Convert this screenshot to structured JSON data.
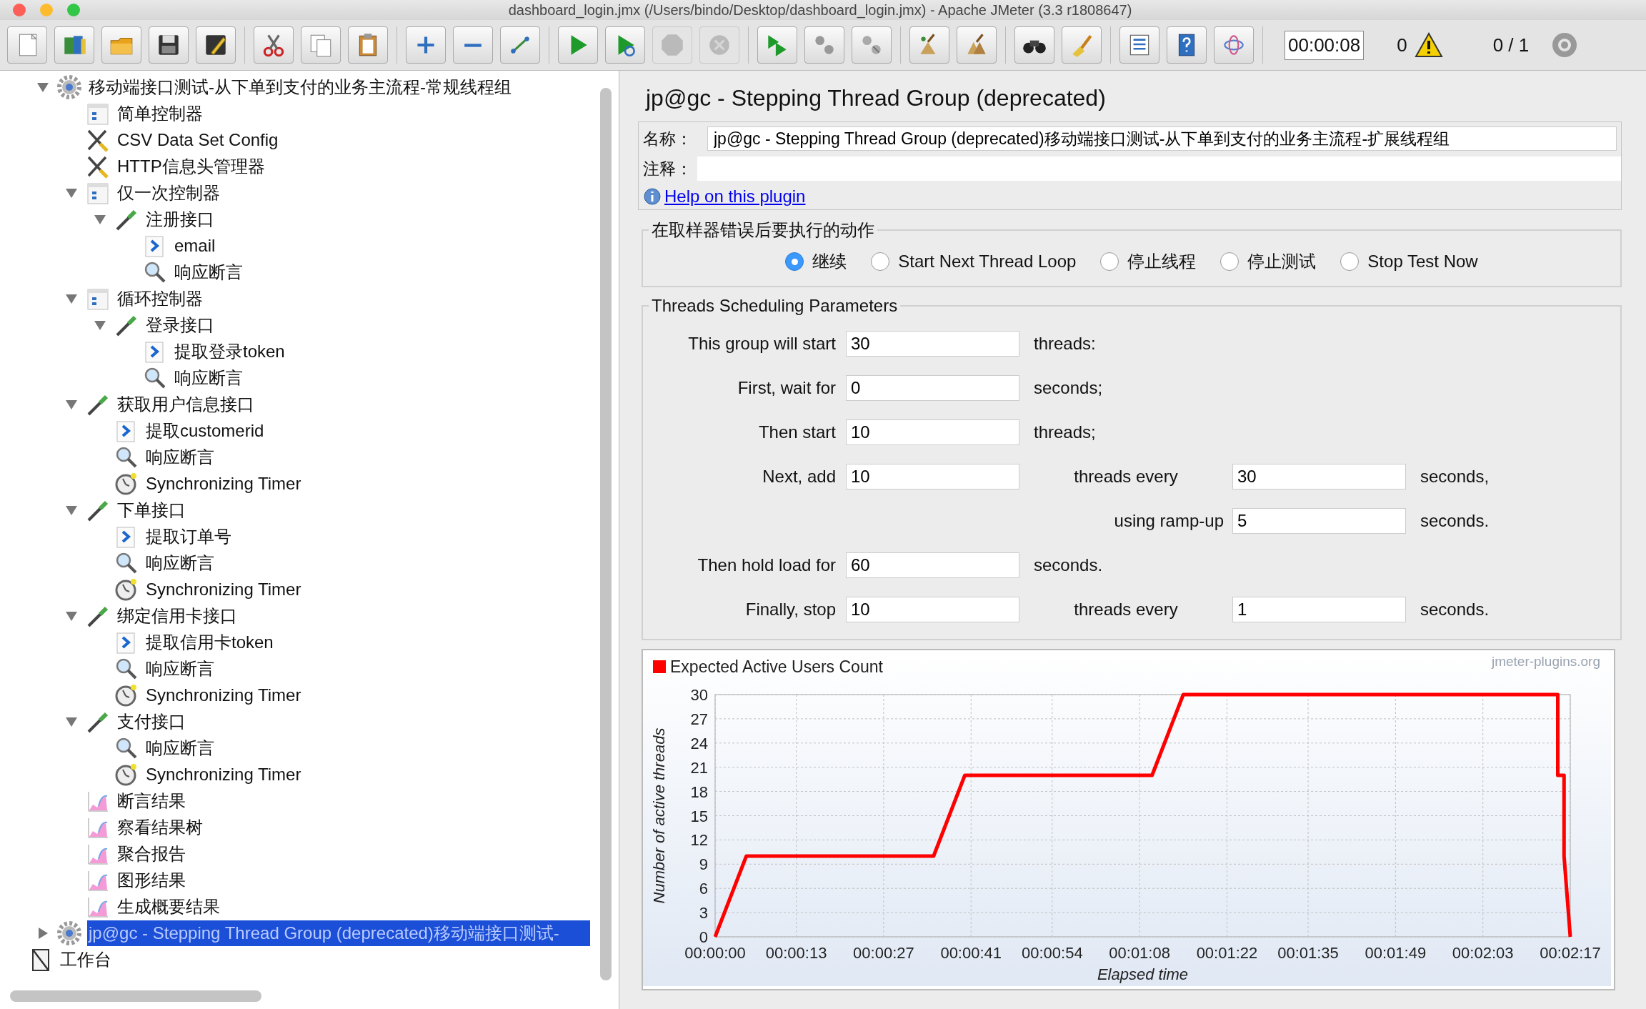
{
  "window": {
    "title": "dashboard_login.jmx (/Users/bindo/Desktop/dashboard_login.jmx) - Apache JMeter (3.3 r1808647)"
  },
  "toolbar": {
    "groups": [
      {
        "buttons": [
          {
            "kind": "new",
            "disabled": false
          },
          {
            "kind": "templates",
            "disabled": false
          },
          {
            "kind": "open",
            "disabled": false
          },
          {
            "kind": "save",
            "disabled": false
          },
          {
            "kind": "save_as",
            "disabled": false
          }
        ]
      },
      {
        "buttons": [
          {
            "kind": "cut",
            "disabled": false
          },
          {
            "kind": "copy",
            "disabled": false
          },
          {
            "kind": "paste",
            "disabled": false
          }
        ]
      },
      {
        "buttons": [
          {
            "kind": "expand",
            "disabled": false
          },
          {
            "kind": "collapse",
            "disabled": false
          },
          {
            "kind": "toggle",
            "disabled": false
          }
        ]
      },
      {
        "buttons": [
          {
            "kind": "start",
            "disabled": false
          },
          {
            "kind": "start_no_pause",
            "disabled": false
          },
          {
            "kind": "stop",
            "disabled": true
          },
          {
            "kind": "shutdown",
            "disabled": true
          }
        ]
      },
      {
        "buttons": [
          {
            "kind": "remote_start",
            "disabled": false
          },
          {
            "kind": "remote_stop",
            "disabled": false
          },
          {
            "kind": "remote_shutdown",
            "disabled": false
          }
        ]
      },
      {
        "buttons": [
          {
            "kind": "clear",
            "disabled": false
          },
          {
            "kind": "clear_all",
            "disabled": false
          }
        ]
      },
      {
        "buttons": [
          {
            "kind": "search",
            "disabled": false
          },
          {
            "kind": "reset_search",
            "disabled": false
          }
        ]
      },
      {
        "buttons": [
          {
            "kind": "function_helper",
            "disabled": false
          },
          {
            "kind": "help",
            "disabled": false
          },
          {
            "kind": "log",
            "disabled": false
          }
        ]
      }
    ],
    "elapsed": "00:00:08",
    "error_count": "0",
    "threads": "0 / 1"
  },
  "tree": [
    {
      "label": "移动端接口测试-从下单到支付的业务主流程-常规线程组",
      "kind": "thread_group",
      "selected": false,
      "expanded": true,
      "children": [
        {
          "label": "简单控制器",
          "kind": "controller",
          "selected": false
        },
        {
          "label": "CSV Data Set Config",
          "kind": "config",
          "selected": false
        },
        {
          "label": "HTTP信息头管理器",
          "kind": "config",
          "selected": false
        },
        {
          "label": "仅一次控制器",
          "kind": "controller",
          "selected": false,
          "expanded": true,
          "children": [
            {
              "label": "注册接口",
              "kind": "sampler",
              "selected": false,
              "expanded": true,
              "children": [
                {
                  "label": "email",
                  "kind": "extractor",
                  "selected": false
                },
                {
                  "label": "响应断言",
                  "kind": "assertion",
                  "selected": false
                }
              ]
            }
          ]
        },
        {
          "label": "循环控制器",
          "kind": "controller",
          "selected": false,
          "expanded": true,
          "children": [
            {
              "label": "登录接口",
              "kind": "sampler",
              "selected": false,
              "expanded": true,
              "children": [
                {
                  "label": "提取登录token",
                  "kind": "extractor",
                  "selected": false
                },
                {
                  "label": "响应断言",
                  "kind": "assertion",
                  "selected": false
                }
              ]
            }
          ]
        },
        {
          "label": "获取用户信息接口",
          "kind": "sampler",
          "selected": false,
          "expanded": true,
          "children": [
            {
              "label": "提取customerid",
              "kind": "extractor",
              "selected": false
            },
            {
              "label": "响应断言",
              "kind": "assertion",
              "selected": false
            },
            {
              "label": "Synchronizing Timer",
              "kind": "timer",
              "selected": false
            }
          ]
        },
        {
          "label": "下单接口",
          "kind": "sampler",
          "selected": false,
          "expanded": true,
          "children": [
            {
              "label": "提取订单号",
              "kind": "extractor",
              "selected": false
            },
            {
              "label": "响应断言",
              "kind": "assertion",
              "selected": false
            },
            {
              "label": "Synchronizing Timer",
              "kind": "timer",
              "selected": false
            }
          ]
        },
        {
          "label": "绑定信用卡接口",
          "kind": "sampler",
          "selected": false,
          "expanded": true,
          "children": [
            {
              "label": "提取信用卡token",
              "kind": "extractor",
              "selected": false
            },
            {
              "label": "响应断言",
              "kind": "assertion",
              "selected": false
            },
            {
              "label": "Synchronizing Timer",
              "kind": "timer",
              "selected": false
            }
          ]
        },
        {
          "label": "支付接口",
          "kind": "sampler",
          "selected": false,
          "expanded": true,
          "children": [
            {
              "label": "响应断言",
              "kind": "assertion",
              "selected": false
            },
            {
              "label": "Synchronizing Timer",
              "kind": "timer",
              "selected": false
            }
          ]
        },
        {
          "label": "断言结果",
          "kind": "listener",
          "selected": false
        },
        {
          "label": "察看结果树",
          "kind": "listener",
          "selected": false
        },
        {
          "label": "聚合报告",
          "kind": "listener",
          "selected": false
        },
        {
          "label": "图形结果",
          "kind": "listener",
          "selected": false
        },
        {
          "label": "生成概要结果",
          "kind": "listener",
          "selected": false
        }
      ]
    },
    {
      "label": "jp@gc - Stepping Thread Group (deprecated)移动端接口测试-",
      "kind": "thread_group",
      "selected": true,
      "expanded": false
    }
  ],
  "workbench": {
    "label": "工作台"
  },
  "editor": {
    "title": "jp@gc - Stepping Thread Group (deprecated)",
    "name_label": "名称：",
    "name_value": "jp@gc - Stepping Thread Group (deprecated)移动端接口测试-从下单到支付的业务主流程-扩展线程组",
    "comment_label": "注释：",
    "help_link": "Help on this plugin",
    "error_action": {
      "title": "在取样器错误后要执行的动作",
      "options": [
        {
          "label": "继续",
          "selected": true
        },
        {
          "label": "Start Next Thread Loop",
          "selected": false
        },
        {
          "label": "停止线程",
          "selected": false
        },
        {
          "label": "停止测试",
          "selected": false
        },
        {
          "label": "Stop Test Now",
          "selected": false
        }
      ]
    },
    "schedule": {
      "title": "Threads Scheduling Parameters",
      "rows": [
        {
          "kind": "single",
          "label": "This group will start",
          "value": "30",
          "unit": "threads:"
        },
        {
          "kind": "single",
          "label": "First, wait for",
          "value": "0",
          "unit": "seconds;"
        },
        {
          "kind": "single",
          "label": "Then start",
          "value": "10",
          "unit": "threads;"
        },
        {
          "kind": "double",
          "label": "Next, add",
          "value": "10",
          "middle": "threads every",
          "value2": "30",
          "unit": "seconds,"
        },
        {
          "kind": "ramp",
          "middle": "using ramp-up",
          "value2": "5",
          "unit": "seconds."
        },
        {
          "kind": "single",
          "label": "Then hold load for",
          "value": "60",
          "unit": "seconds."
        },
        {
          "kind": "double",
          "label": "Finally, stop",
          "value": "10",
          "middle": "threads every",
          "value2": "1",
          "unit": "seconds."
        }
      ]
    },
    "chart": {
      "credit": "jmeter-plugins.org",
      "chart_data": {
        "type": "line",
        "xlabel": "Elapsed time",
        "ylabel": "Number of active threads",
        "x": [
          0,
          5,
          35,
          40,
          70,
          75,
          135,
          135,
          136,
          136,
          137
        ],
        "series": [
          {
            "name": "Expected Active Users Count",
            "color": "#ff0000",
            "values": [
              0,
              10,
              10,
              20,
              20,
              30,
              30,
              20,
              20,
              10,
              0
            ]
          }
        ],
        "xlim": [
          0,
          137
        ],
        "ylim": [
          0,
          30
        ],
        "xticks": [
          {
            "value": 0,
            "label": "00:00:00"
          },
          {
            "value": 13,
            "label": "00:00:13"
          },
          {
            "value": 27,
            "label": "00:00:27"
          },
          {
            "value": 41,
            "label": "00:00:41"
          },
          {
            "value": 54,
            "label": "00:00:54"
          },
          {
            "value": 68,
            "label": "00:01:08"
          },
          {
            "value": 82,
            "label": "00:01:22"
          },
          {
            "value": 95,
            "label": "00:01:35"
          },
          {
            "value": 109,
            "label": "00:01:49"
          },
          {
            "value": 123,
            "label": "00:02:03"
          },
          {
            "value": 137,
            "label": "00:02:17"
          }
        ],
        "grid": true,
        "yticks": [
          0,
          3,
          6,
          9,
          12,
          15,
          18,
          21,
          24,
          27,
          30
        ]
      }
    }
  }
}
